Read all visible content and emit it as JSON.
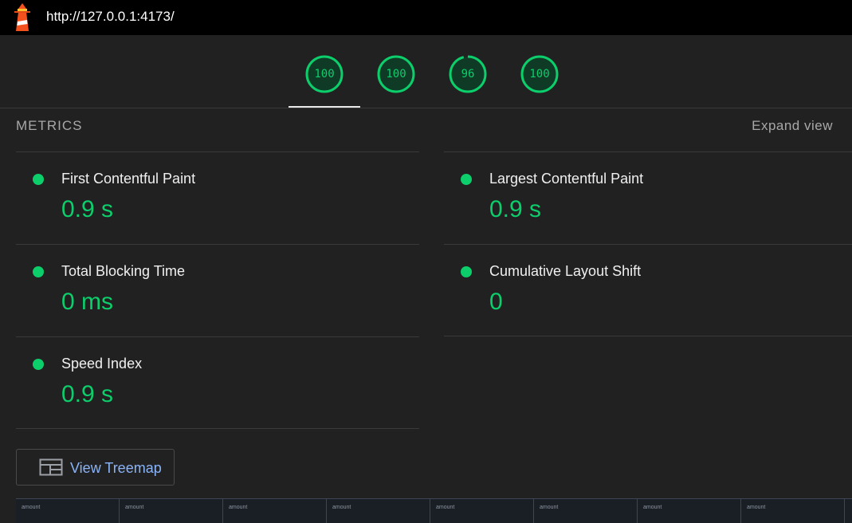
{
  "browser": {
    "url": "http://127.0.0.1:4173/"
  },
  "scores": [
    {
      "value": "100",
      "fraction": 1.0
    },
    {
      "value": "100",
      "fraction": 1.0
    },
    {
      "value": "96",
      "fraction": 0.96
    },
    {
      "value": "100",
      "fraction": 1.0
    }
  ],
  "metrics": {
    "header": "METRICS",
    "expand_label": "Expand view",
    "items": [
      {
        "name": "First Contentful Paint",
        "value": "0.9 s"
      },
      {
        "name": "Largest Contentful Paint",
        "value": "0.9 s"
      },
      {
        "name": "Total Blocking Time",
        "value": "0 ms"
      },
      {
        "name": "Cumulative Layout Shift",
        "value": "0"
      },
      {
        "name": "Speed Index",
        "value": "0.9 s"
      }
    ]
  },
  "treemap": {
    "label": "View Treemap"
  },
  "table_strip": {
    "headers": [
      "amount",
      "amount",
      "amount",
      "amount",
      "amount",
      "amount",
      "amount",
      "amount"
    ]
  },
  "colors": {
    "pass": "#0cce6b",
    "link": "#8ab4f8",
    "background": "#212121"
  }
}
